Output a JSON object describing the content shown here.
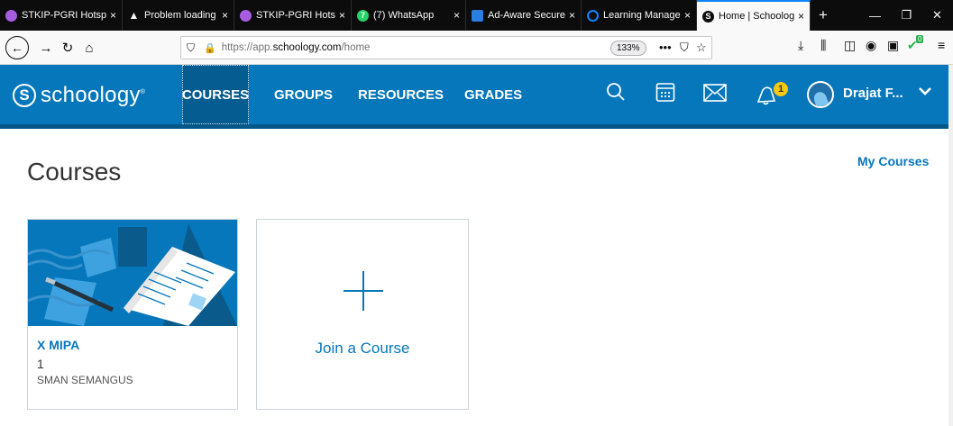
{
  "browser": {
    "tabs": [
      {
        "title": "STKIP-PGRI Hotspot",
        "icon_color": "#a75de0",
        "close": "×",
        "active": false
      },
      {
        "title": "Problem loading page",
        "icon_color": "#0c0c0d",
        "close": "×",
        "active": false
      },
      {
        "title": "STKIP-PGRI Hotspot",
        "icon_color": "#a75de0",
        "close": "×",
        "active": false
      },
      {
        "title": "(7) WhatsApp",
        "icon_color": "#25d366",
        "close": "×",
        "active": false
      },
      {
        "title": "Ad-Aware SecureSearch",
        "icon_color": "#2a7de1",
        "close": "×",
        "active": false
      },
      {
        "title": "Learning Management",
        "icon_color": "#0a84ff",
        "close": "×",
        "active": false
      },
      {
        "title": "Home | Schoology",
        "icon_color": "#0c0c0d",
        "close": "×",
        "active": true
      }
    ],
    "new_tab": "+",
    "url_prefix": "https://app.",
    "url_host": "schoology.com",
    "url_path": "/home",
    "zoom": "133%",
    "page_actions": "•••",
    "badge_count": "0"
  },
  "schoology": {
    "logo_text": "schoology",
    "nav": [
      "COURSES",
      "GROUPS",
      "RESOURCES",
      "GRADES"
    ],
    "active_nav": "COURSES",
    "notification_count": "1",
    "user_name": "Drajat F...",
    "brand_color": "#0677ba"
  },
  "page": {
    "title": "Courses",
    "my_courses_link": "My Courses",
    "course": {
      "name": "X MIPA",
      "section": "1",
      "school": "SMAN SEMANGUS"
    },
    "join_label": "Join a Course"
  }
}
